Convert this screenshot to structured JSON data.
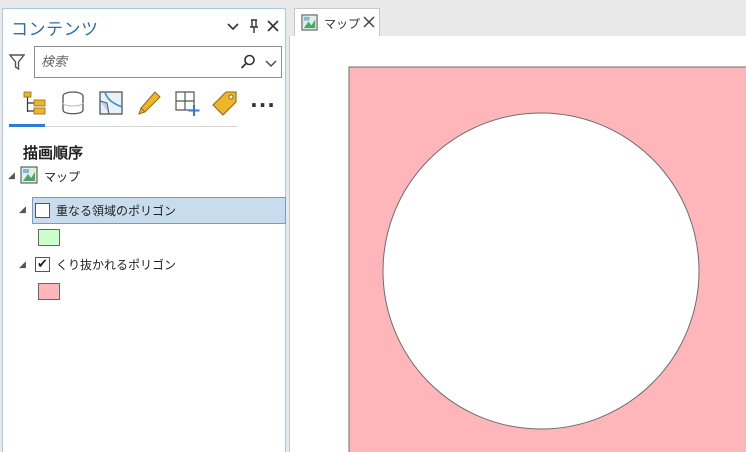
{
  "contents_pane": {
    "title": "コンテンツ",
    "search": {
      "placeholder": "検索",
      "value": ""
    },
    "section_title": "描画順序",
    "tree": {
      "map_label": "マップ",
      "layers": [
        {
          "label": "重なる領域のポリゴン",
          "checked": false,
          "selected": true,
          "swatch_color": "#ccffcc"
        },
        {
          "label": "くり抜かれるポリゴン",
          "checked": true,
          "selected": false,
          "swatch_color": "#ffb6bb"
        }
      ]
    },
    "toolbar": {
      "items": [
        "list-by-drawing-order-icon",
        "list-by-data-source-icon",
        "list-by-selection-icon",
        "list-by-editing-icon",
        "list-by-snapping-icon",
        "list-by-labeling-icon",
        "more-icon"
      ],
      "more_label": "..."
    }
  },
  "map_tab": {
    "label": "マップ"
  },
  "map_view": {
    "fill_color": "#ffb6bb",
    "hole_color": "#ffffff",
    "outline_color": "#6e6e6e"
  },
  "colors": {
    "accent": "#2e7cd6",
    "title_blue": "#2e6db4",
    "selection_bg": "#c9dcee"
  }
}
